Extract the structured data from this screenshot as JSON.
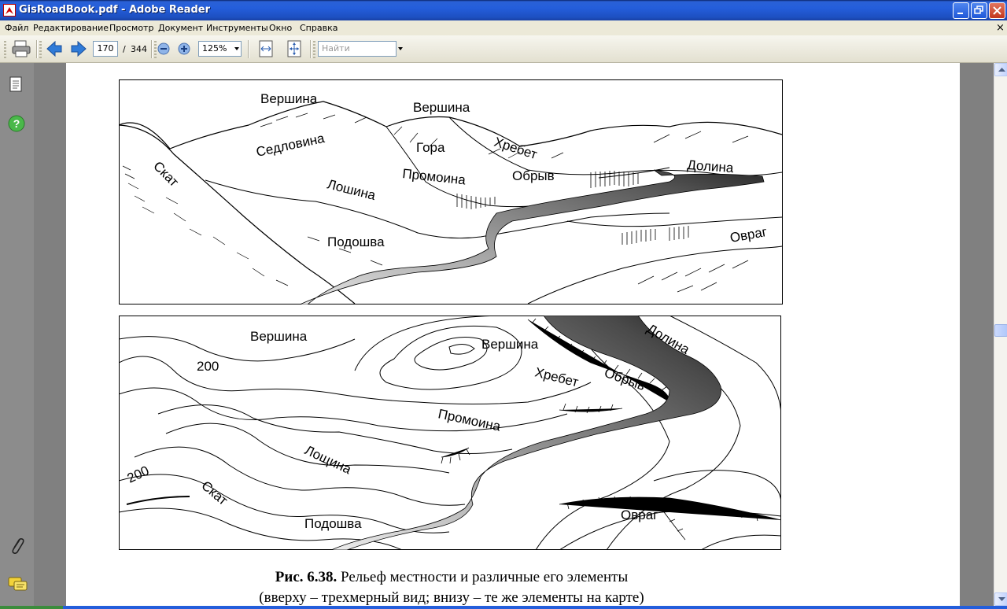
{
  "window": {
    "title": "GisRoadBook.pdf - Adobe Reader",
    "controls": [
      "minimize",
      "maximize",
      "close"
    ]
  },
  "menu": {
    "items": [
      "Файл",
      "Редактирование",
      "Просмотр",
      "Документ",
      "Инструменты",
      "Окно",
      "Справка"
    ],
    "close_glyph": "×"
  },
  "toolbar": {
    "print_icon": "printer-icon",
    "prev_icon": "arrow-left-icon",
    "next_icon": "arrow-right-icon",
    "current_page": "170",
    "page_separator": "/",
    "total_pages": "344",
    "zoom_out_icon": "zoom-out-icon",
    "zoom_in_icon": "zoom-in-icon",
    "zoom_value": "125%",
    "fit_width_icon": "fit-width-icon",
    "fit_page_icon": "fit-page-icon",
    "find_placeholder": "Найти"
  },
  "left_nav": {
    "icons": [
      "pages-icon",
      "help-icon",
      "attachment-icon",
      "comments-icon"
    ]
  },
  "figure": {
    "top_labels": {
      "vershina_1": "Вершина",
      "vershina_2": "Вершина",
      "sedlovina": "Седловина",
      "gora": "Гора",
      "hrebet": "Хребет",
      "skat": "Скат",
      "promoina": "Промоина",
      "obryv": "Обрыв",
      "dolina": "Долина",
      "loshina": "Лошина",
      "podoshva": "Подошва",
      "ovrag": "Овраг"
    },
    "bottom_labels": {
      "vershina_1": "Вершина",
      "vershina_2": "Вершина",
      "contour_200_a": "200",
      "contour_200_b": "200",
      "dolina": "Долина",
      "hrebet": "Хребет",
      "obryv": "Обрыв",
      "promoina": "Промоина",
      "loshina": "Лощина",
      "skat": "Скат",
      "podoshva": "Подошва",
      "ovrag": "Овраг"
    },
    "caption_bold": "Рис. 6.38.",
    "caption_line1": " Рельеф местности и различные его элементы",
    "caption_line2": "(вверху – трехмерный вид; внизу – те же элементы на карте)"
  },
  "colors": {
    "title_bar": "#245edb",
    "doc_background": "#808080",
    "left_nav_background": "#8c8c8c",
    "river_dark": "#3a3a3a",
    "river_light": "#cfcfcf"
  }
}
